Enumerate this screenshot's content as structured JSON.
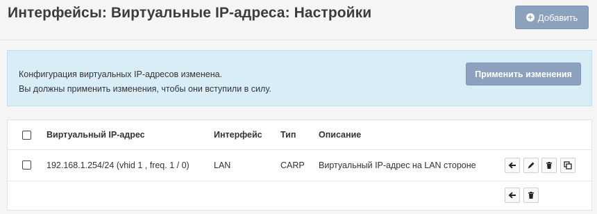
{
  "header": {
    "title": "Интерфейсы: Виртуальные IP-адреса: Настройки",
    "add_label": "Добавить"
  },
  "alert": {
    "line1": "Конфигурация виртуальных IP-адресов изменена.",
    "line2": "Вы должны применить изменения, чтобы они вступили в силу.",
    "apply_label": "Применить изменения",
    "background": "#d9edf7"
  },
  "table": {
    "columns": {
      "address": "Виртуальный IP-адрес",
      "interface": "Интерфейс",
      "type": "Тип",
      "description": "Описание"
    },
    "rows": [
      {
        "address": "192.168.1.254/24 (vhid 1 , freq. 1 / 0)",
        "interface": "LAN",
        "type": "CARP",
        "description": "Виртуальный IP-адрес на LAN стороне",
        "actions": [
          "arrow-left-icon",
          "pencil-icon",
          "trash-icon",
          "copy-icon"
        ]
      }
    ],
    "footer_actions": [
      "arrow-left-icon",
      "trash-icon"
    ]
  },
  "colors": {
    "button": "#8ca1bd",
    "page_bg": "#f5f5f5"
  }
}
